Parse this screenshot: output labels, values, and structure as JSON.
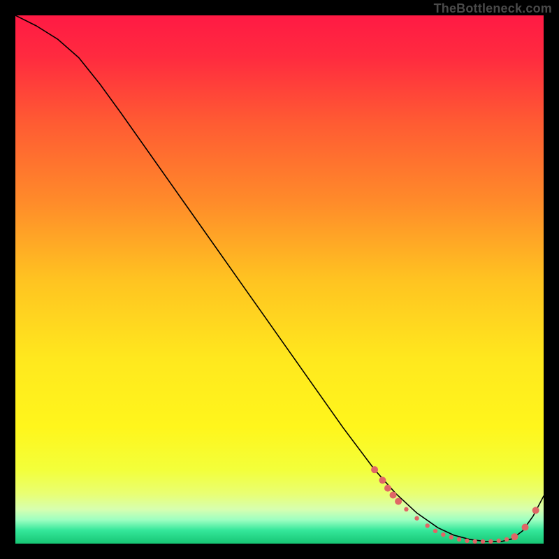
{
  "watermark": "TheBottleneck.com",
  "chart_data": {
    "type": "line",
    "title": "",
    "xlabel": "",
    "ylabel": "",
    "xlim": [
      0,
      100
    ],
    "ylim": [
      0,
      100
    ],
    "background_gradient": {
      "stops": [
        {
          "offset": 0.0,
          "color": "#ff1a44"
        },
        {
          "offset": 0.08,
          "color": "#ff2b3f"
        },
        {
          "offset": 0.2,
          "color": "#ff5a33"
        },
        {
          "offset": 0.35,
          "color": "#ff8a2a"
        },
        {
          "offset": 0.5,
          "color": "#ffc321"
        },
        {
          "offset": 0.65,
          "color": "#ffe81e"
        },
        {
          "offset": 0.78,
          "color": "#fff61c"
        },
        {
          "offset": 0.86,
          "color": "#f3ff3a"
        },
        {
          "offset": 0.905,
          "color": "#e9ff72"
        },
        {
          "offset": 0.935,
          "color": "#d7ffb0"
        },
        {
          "offset": 0.955,
          "color": "#9dffc1"
        },
        {
          "offset": 0.975,
          "color": "#34e79a"
        },
        {
          "offset": 1.0,
          "color": "#17c574"
        }
      ]
    },
    "series": [
      {
        "name": "curve",
        "type": "line",
        "color": "#000000",
        "width": 1.6,
        "x": [
          0,
          4,
          8,
          12,
          16,
          20,
          26,
          32,
          38,
          44,
          50,
          56,
          62,
          68,
          72,
          76,
          80,
          83,
          86,
          89,
          92,
          94,
          96,
          98,
          100
        ],
        "y": [
          100,
          98,
          95.5,
          92,
          87,
          81.5,
          73,
          64.5,
          56,
          47.5,
          39,
          30.5,
          22,
          14,
          9.5,
          5.8,
          3.0,
          1.6,
          0.8,
          0.4,
          0.4,
          0.9,
          2.4,
          5.2,
          9.0
        ]
      },
      {
        "name": "markers",
        "type": "scatter",
        "color": "#e06666",
        "radius_small": 3.2,
        "radius_large": 5.0,
        "points": [
          {
            "x": 68.0,
            "y": 14.0,
            "r": "large"
          },
          {
            "x": 69.5,
            "y": 12.0,
            "r": "large"
          },
          {
            "x": 70.5,
            "y": 10.5,
            "r": "large"
          },
          {
            "x": 71.5,
            "y": 9.2,
            "r": "large"
          },
          {
            "x": 72.5,
            "y": 8.0,
            "r": "large"
          },
          {
            "x": 74.0,
            "y": 6.5,
            "r": "small"
          },
          {
            "x": 76.0,
            "y": 4.8,
            "r": "small"
          },
          {
            "x": 78.0,
            "y": 3.4,
            "r": "small"
          },
          {
            "x": 79.5,
            "y": 2.4,
            "r": "small"
          },
          {
            "x": 81.0,
            "y": 1.7,
            "r": "small"
          },
          {
            "x": 82.5,
            "y": 1.2,
            "r": "small"
          },
          {
            "x": 84.0,
            "y": 0.8,
            "r": "small"
          },
          {
            "x": 85.5,
            "y": 0.55,
            "r": "small"
          },
          {
            "x": 87.0,
            "y": 0.42,
            "r": "small"
          },
          {
            "x": 88.5,
            "y": 0.4,
            "r": "small"
          },
          {
            "x": 90.0,
            "y": 0.42,
            "r": "small"
          },
          {
            "x": 91.5,
            "y": 0.55,
            "r": "small"
          },
          {
            "x": 93.0,
            "y": 0.8,
            "r": "small"
          },
          {
            "x": 94.5,
            "y": 1.3,
            "r": "large"
          },
          {
            "x": 96.5,
            "y": 3.1,
            "r": "large"
          },
          {
            "x": 98.5,
            "y": 6.3,
            "r": "large"
          }
        ]
      }
    ]
  }
}
